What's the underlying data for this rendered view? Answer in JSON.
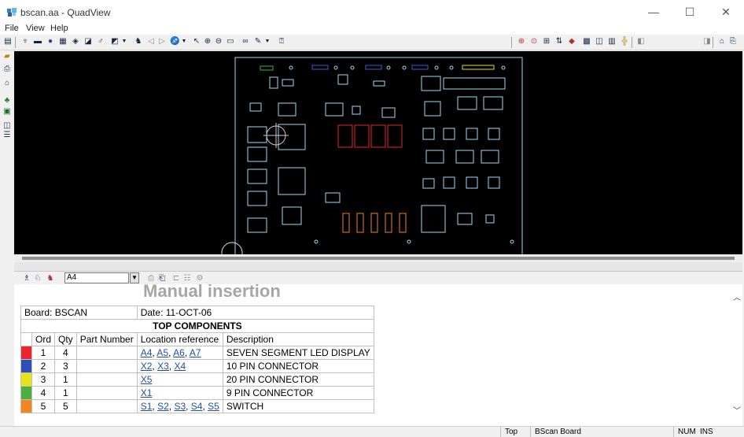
{
  "window": {
    "title": "bscan.aa - QuadView",
    "controls": [
      "—",
      "☐",
      "✕"
    ]
  },
  "menu": [
    "File",
    "View",
    "Help"
  ],
  "toolbar": {
    "left_icons": [
      "open-icon",
      "print-icon",
      "info-icon",
      "grid-icon",
      "layers-icon",
      "net-icon",
      "probe-icon",
      "view-dropdown-icon",
      "find-icon",
      "prev-icon",
      "next-icon",
      "select-dropdown-icon",
      "pointer-icon",
      "zoom-in-icon",
      "zoom-out-icon",
      "zoom-box-icon",
      "glasses-icon",
      "pen-dropdown-icon",
      "help-icon"
    ],
    "right_icons": [
      "target-icon",
      "circle-icon",
      "align-icon",
      "swap-icon",
      "color-icon",
      "component-icon",
      "pane-icon",
      "tile-icon",
      "split-icon",
      "export-icon",
      "doc-icon",
      "print-preview-icon",
      "copy-icon"
    ]
  },
  "left_tools": [
    "open-icon",
    "print-icon",
    "home-icon",
    "bom-icon",
    "board-icon",
    "tile-icon",
    "stack-icon"
  ],
  "bom_toolbar": {
    "reference_value": "A4"
  },
  "report": {
    "heading": "Manual insertion",
    "board_label": "Board: BSCAN",
    "date_label": "Date: 11-OCT-06",
    "section_title": "TOP COMPONENTS",
    "columns": [
      "Ord",
      "Qty",
      "Part Number",
      "Location reference",
      "Description"
    ],
    "rows": [
      {
        "color": "#e8262b",
        "ord": "1",
        "qty": "4",
        "part": "",
        "refs": [
          "A4",
          "A5",
          "A6",
          "A7"
        ],
        "description": "SEVEN SEGMENT LED DISPLAY"
      },
      {
        "color": "#2a4fb5",
        "ord": "2",
        "qty": "3",
        "part": "",
        "refs": [
          "X2",
          "X3",
          "X4"
        ],
        "description": "10 PIN CONNECTOR"
      },
      {
        "color": "#e9e218",
        "ord": "3",
        "qty": "1",
        "part": "",
        "refs": [
          "X5"
        ],
        "description": "20 PIN CONNECTOR"
      },
      {
        "color": "#4cae3f",
        "ord": "4",
        "qty": "1",
        "part": "",
        "refs": [
          "X1"
        ],
        "description": "9 PIN CONNECTOR"
      },
      {
        "color": "#f08522",
        "ord": "5",
        "qty": "5",
        "part": "",
        "refs": [
          "S1",
          "S2",
          "S3",
          "S4",
          "S5"
        ],
        "description": "SWITCH"
      }
    ]
  },
  "status": {
    "side": "Top",
    "board": "BScan Board",
    "num": "NUM",
    "ins": "INS"
  },
  "colors": {
    "pcb_outline": "#9fd8f0",
    "led_display": "#e8262b",
    "connector_blue": "#3b5bd6",
    "connector_yellow": "#e9e218",
    "connector_green": "#4cae3f",
    "switch_orange": "#f08522",
    "link": "#1f4fa0"
  }
}
